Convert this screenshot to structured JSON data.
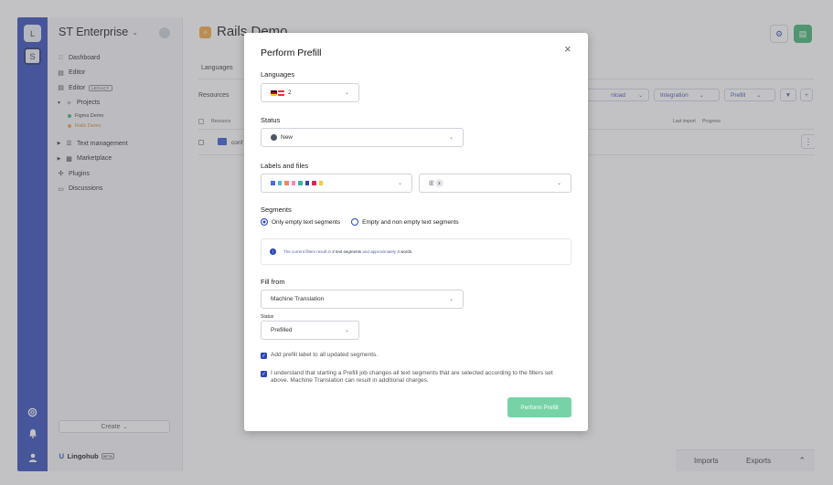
{
  "rail": {
    "workspace_1": "L",
    "workspace_2": "S",
    "icons": [
      "help-icon",
      "bell-icon",
      "user-icon"
    ]
  },
  "sidebar": {
    "org_name": "ST Enterprise",
    "items": [
      {
        "label": "Dashboard",
        "icon": "dashboard-icon"
      },
      {
        "label": "Editor",
        "icon": "editor-icon"
      },
      {
        "label": "Editor",
        "icon": "editor-icon",
        "badge": "LEGACY"
      },
      {
        "label": "Projects",
        "icon": "projects-icon"
      }
    ],
    "projects": [
      {
        "label": "Figma Demo",
        "color": "#3ab36e"
      },
      {
        "label": "Rails Demo",
        "color": "#f1a43b"
      }
    ],
    "items_after": [
      {
        "label": "Text management",
        "icon": "text-icon"
      },
      {
        "label": "Marketplace",
        "icon": "cart-icon"
      },
      {
        "label": "Plugins",
        "icon": "plugin-icon"
      },
      {
        "label": "Discussions",
        "icon": "chat-icon"
      }
    ],
    "create_label": "Create",
    "brand": "Lingohub",
    "beta": "BETA"
  },
  "main": {
    "project_title": "Rails Demo",
    "tab_languages": "Languages",
    "resources_label": "Resources",
    "toolbar": {
      "download": "nload",
      "integration": "Integration",
      "prefill": "Prefill"
    },
    "columns": {
      "resource": "Resource",
      "last_import": "Last import",
      "progress": "Progress"
    },
    "row_name": "conf",
    "bottom": {
      "imports": "Imports",
      "exports": "Exports"
    }
  },
  "modal": {
    "title": "Perform Prefill",
    "languages_label": "Languages",
    "languages_value": "2",
    "status_label": "Status",
    "status_value": "New",
    "labels_label": "Labels and files",
    "label_colors": [
      "#4f6bd8",
      "#4fb5e0",
      "#f08a5d",
      "#f58bc3",
      "#3ab3a8",
      "#2c46b8",
      "#e0245e",
      "#f5c842"
    ],
    "files_count": "3",
    "segments_label": "Segments",
    "segments_opt1": "Only empty text segments",
    "segments_opt2": "Empty and non empty text segments",
    "info_pre": "The current filters result in",
    "info_count": "2 text segments",
    "info_mid": "and approximately",
    "info_words": "4 words.",
    "fill_from_label": "Fill from",
    "fill_from_value": "Machine Translation",
    "status2_label": "Status",
    "status2_value": "Prefilled",
    "check1": "Add prefill label to all updated segments.",
    "check2": "I understand that starting a Prefill job changes all text segments that are selected according to the filters set above. Machine Translation can result in additional charges.",
    "submit": "Perform Prefill"
  }
}
